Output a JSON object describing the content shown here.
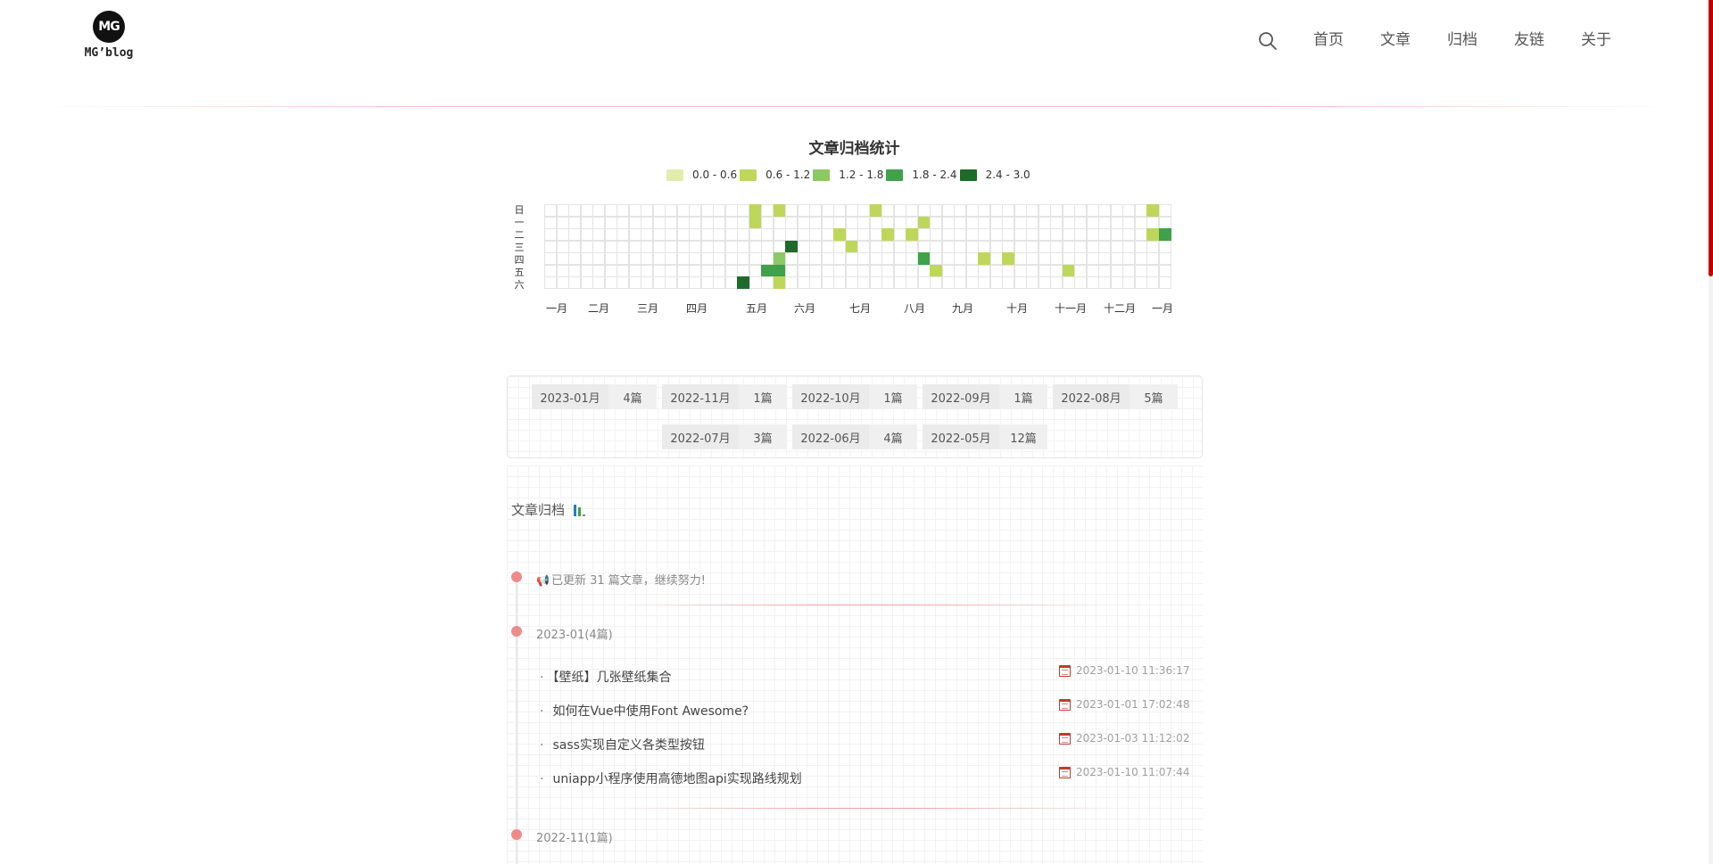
{
  "header": {
    "logo_mark": "MG",
    "logo_text": "MG’blog",
    "nav": [
      {
        "label": "首页"
      },
      {
        "label": "文章"
      },
      {
        "label": "归档"
      },
      {
        "label": "友链"
      },
      {
        "label": "关于"
      }
    ],
    "search_icon": "search-icon"
  },
  "heatmap": {
    "title": "文章归档统计",
    "legend": [
      {
        "label": "0.0 - 0.6",
        "color": "#e2ecad"
      },
      {
        "label": "0.6 - 1.2",
        "color": "#bed75b"
      },
      {
        "label": "1.2 - 1.8",
        "color": "#8cc865"
      },
      {
        "label": "1.8 - 2.4",
        "color": "#3fa14a"
      },
      {
        "label": "2.4 - 3.0",
        "color": "#1f6a2a"
      }
    ],
    "day_labels": [
      "日",
      "一",
      "二",
      "三",
      "四",
      "五",
      "六"
    ],
    "month_labels": [
      "一月",
      "二月",
      "三月",
      "四月",
      "五月",
      "六月",
      "七月",
      "八月",
      "九月",
      "十月",
      "十一月",
      "十二月",
      "一月"
    ],
    "weeks": 52,
    "filled_cells": [
      {
        "week": 16,
        "day": 6,
        "level": 4
      },
      {
        "week": 17,
        "day": 0,
        "level": 1
      },
      {
        "week": 17,
        "day": 1,
        "level": 1
      },
      {
        "week": 18,
        "day": 5,
        "level": 3
      },
      {
        "week": 19,
        "day": 0,
        "level": 1
      },
      {
        "week": 19,
        "day": 4,
        "level": 2
      },
      {
        "week": 19,
        "day": 5,
        "level": 3
      },
      {
        "week": 19,
        "day": 6,
        "level": 1
      },
      {
        "week": 20,
        "day": 3,
        "level": 4
      },
      {
        "week": 24,
        "day": 2,
        "level": 1
      },
      {
        "week": 25,
        "day": 3,
        "level": 1
      },
      {
        "week": 27,
        "day": 0,
        "level": 1
      },
      {
        "week": 28,
        "day": 2,
        "level": 1
      },
      {
        "week": 30,
        "day": 2,
        "level": 1
      },
      {
        "week": 31,
        "day": 1,
        "level": 1
      },
      {
        "week": 31,
        "day": 4,
        "level": 3
      },
      {
        "week": 32,
        "day": 5,
        "level": 1
      },
      {
        "week": 36,
        "day": 4,
        "level": 1
      },
      {
        "week": 38,
        "day": 4,
        "level": 1
      },
      {
        "week": 43,
        "day": 5,
        "level": 1
      },
      {
        "week": 50,
        "day": 0,
        "level": 1
      },
      {
        "week": 50,
        "day": 2,
        "level": 1
      },
      {
        "week": 51,
        "day": 2,
        "level": 3
      }
    ]
  },
  "archive_tags": [
    {
      "date": "2023-01月",
      "count": "4篇"
    },
    {
      "date": "2022-11月",
      "count": "1篇"
    },
    {
      "date": "2022-10月",
      "count": "1篇"
    },
    {
      "date": "2022-09月",
      "count": "1篇"
    },
    {
      "date": "2022-08月",
      "count": "5篇"
    },
    {
      "date": "2022-07月",
      "count": "3篇"
    },
    {
      "date": "2022-06月",
      "count": "4篇"
    },
    {
      "date": "2022-05月",
      "count": "12篇"
    }
  ],
  "archive": {
    "title": "文章归档",
    "notice": "已更新 31 篇文章，继续努力!",
    "groups": [
      {
        "label": "2023-01(4篇)",
        "posts": [
          {
            "title": "【壁纸】几张壁纸集合",
            "date": "2023-01-10 11:36:17"
          },
          {
            "title": "如何在Vue中使用Font Awesome?",
            "date": "2023-01-01 17:02:48"
          },
          {
            "title": "sass实现自定义各类型按钮",
            "date": "2023-01-03 11:12:02"
          },
          {
            "title": "uniapp小程序使用高德地图api实现路线规划",
            "date": "2023-01-10 11:07:44"
          }
        ]
      },
      {
        "label": "2022-11(1篇)",
        "posts": []
      }
    ]
  }
}
